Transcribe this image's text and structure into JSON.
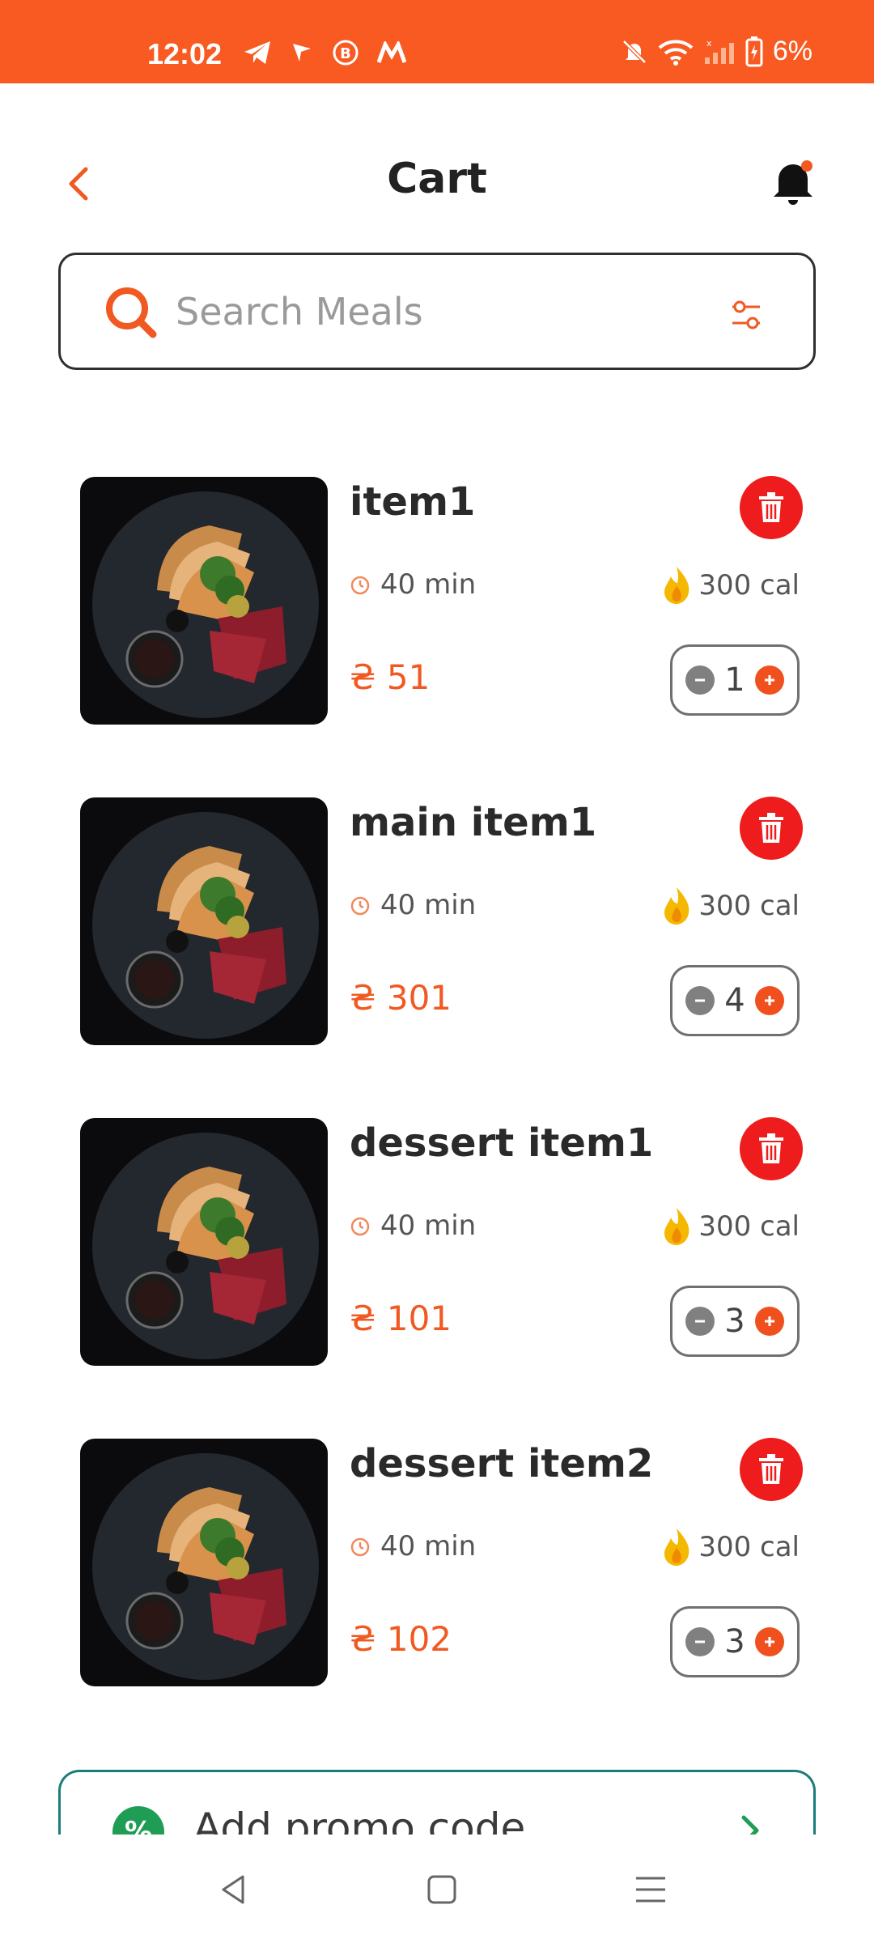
{
  "status_bar": {
    "time": "12:02",
    "battery": "6%",
    "background_color": "#f85a22"
  },
  "header": {
    "title": "Cart",
    "back_icon": "chevron-left-icon",
    "notification_icon": "bell-icon",
    "accent_color": "#f05a22"
  },
  "search": {
    "placeholder": "Search Meals",
    "value": ""
  },
  "cart": {
    "items": [
      {
        "name": "item1",
        "time": "40 min",
        "calories": "300 cal",
        "price": "₴ 51",
        "quantity": "1"
      },
      {
        "name": "main item1",
        "time": "40 min",
        "calories": "300 cal",
        "price": "₴ 301",
        "quantity": "4"
      },
      {
        "name": "dessert item1",
        "time": "40 min",
        "calories": "300 cal",
        "price": "₴ 101",
        "quantity": "3"
      },
      {
        "name": "dessert item2",
        "time": "40 min",
        "calories": "300 cal",
        "price": "₴ 102",
        "quantity": "3"
      }
    ]
  },
  "promo": {
    "label": "Add promo code",
    "icon": "percent-icon",
    "color": "#1f9d55"
  },
  "nav": {
    "back": "nav-back-icon",
    "home": "nav-home-icon",
    "menu": "nav-menu-icon"
  }
}
